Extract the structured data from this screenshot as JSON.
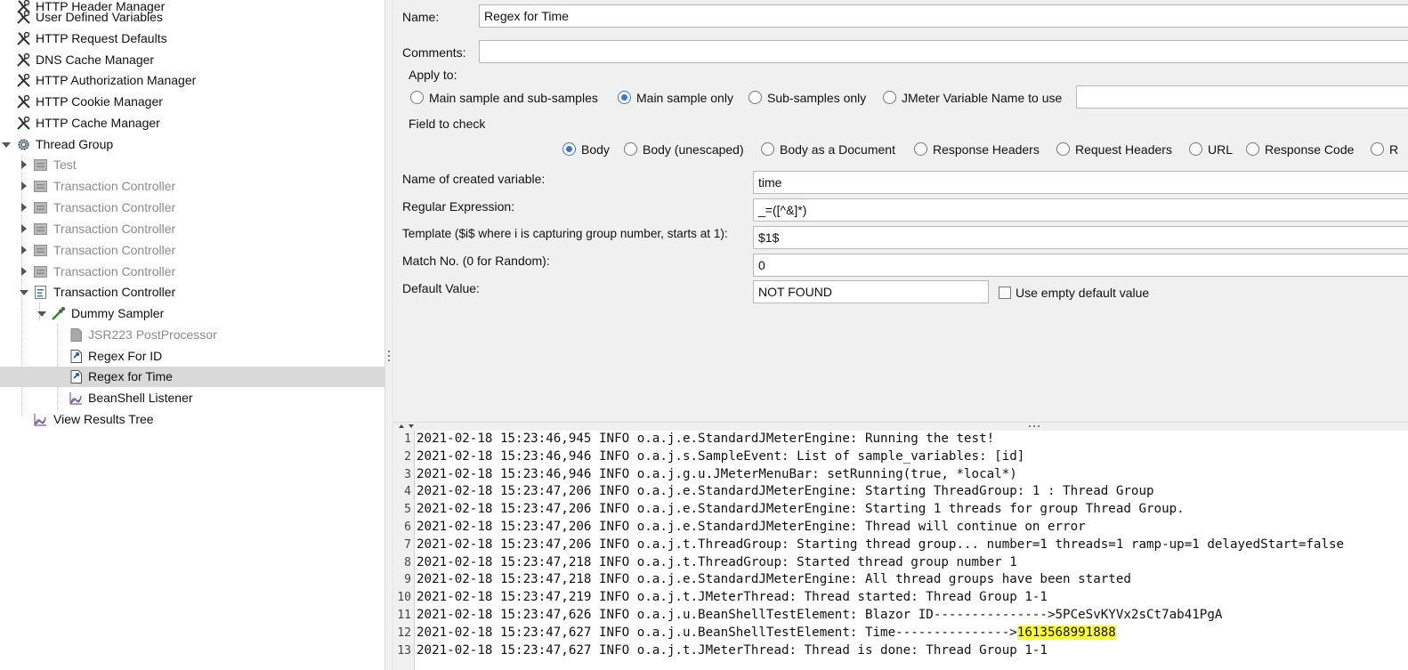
{
  "tree": {
    "items": [
      {
        "label": "HTTP Header Manager",
        "icon": "wrench-icon",
        "disabled": false
      },
      {
        "label": "User Defined Variables",
        "icon": "wrench-icon",
        "disabled": false
      },
      {
        "label": "HTTP Request Defaults",
        "icon": "wrench-icon",
        "disabled": false
      },
      {
        "label": "DNS Cache Manager",
        "icon": "wrench-icon",
        "disabled": false
      },
      {
        "label": "HTTP Authorization Manager",
        "icon": "wrench-icon",
        "disabled": false
      },
      {
        "label": "HTTP Cookie Manager",
        "icon": "wrench-icon",
        "disabled": false
      },
      {
        "label": "HTTP Cache Manager",
        "icon": "wrench-icon",
        "disabled": false
      },
      {
        "label": "Thread Group",
        "icon": "gear-icon",
        "disabled": false
      },
      {
        "label": "Test",
        "icon": "controller-icon",
        "disabled": true
      },
      {
        "label": "Transaction Controller",
        "icon": "controller-icon",
        "disabled": true
      },
      {
        "label": "Transaction Controller",
        "icon": "controller-icon",
        "disabled": true
      },
      {
        "label": "Transaction Controller",
        "icon": "controller-icon",
        "disabled": true
      },
      {
        "label": "Transaction Controller",
        "icon": "controller-icon",
        "disabled": true
      },
      {
        "label": "Transaction Controller",
        "icon": "controller-icon",
        "disabled": true
      },
      {
        "label": "Transaction Controller",
        "icon": "controller-icon",
        "disabled": false
      },
      {
        "label": "Dummy Sampler",
        "icon": "pipette-icon",
        "disabled": false
      },
      {
        "label": "JSR223 PostProcessor",
        "icon": "postprocessor-icon",
        "disabled": true
      },
      {
        "label": "Regex For ID",
        "icon": "postprocessor-icon",
        "disabled": false
      },
      {
        "label": "Regex for Time",
        "icon": "postprocessor-icon",
        "disabled": false
      },
      {
        "label": "BeanShell Listener",
        "icon": "chart-icon",
        "disabled": false
      },
      {
        "label": "View Results Tree",
        "icon": "chart-icon",
        "disabled": false
      }
    ]
  },
  "form": {
    "name_label": "Name:",
    "name_value": "Regex for Time",
    "comments_label": "Comments:",
    "comments_value": "",
    "apply_to_label": "Apply to:",
    "apply_to_options": [
      "Main sample and sub-samples",
      "Main sample only",
      "Sub-samples only",
      "JMeter Variable Name to use"
    ],
    "apply_to_selected": "Main sample only",
    "jmeter_var_value": "",
    "field_to_check_label": "Field to check",
    "field_options": [
      "Body",
      "Body (unescaped)",
      "Body as a Document",
      "Response Headers",
      "Request Headers",
      "URL",
      "Response Code",
      "R"
    ],
    "field_selected": "Body",
    "created_var_label": "Name of created variable:",
    "created_var_value": "time",
    "regex_label": "Regular Expression:",
    "regex_value": "_=([^&]*)",
    "template_label": "Template ($i$ where i is capturing group number, starts at 1):",
    "template_value": "$1$",
    "match_no_label": "Match No. (0 for Random):",
    "match_no_value": "0",
    "default_label": "Default Value:",
    "default_value": "NOT FOUND",
    "use_empty_label": "Use empty default value",
    "use_empty_checked": false
  },
  "console": {
    "lines": [
      {
        "n": "1",
        "text": "2021-02-18 15:23:46,945 INFO o.a.j.e.StandardJMeterEngine: Running the test!",
        "hl": ""
      },
      {
        "n": "2",
        "text": "2021-02-18 15:23:46,946 INFO o.a.j.s.SampleEvent: List of sample_variables: [id]",
        "hl": ""
      },
      {
        "n": "3",
        "text": "2021-02-18 15:23:46,946 INFO o.a.j.g.u.JMeterMenuBar: setRunning(true, *local*)",
        "hl": ""
      },
      {
        "n": "4",
        "text": "2021-02-18 15:23:47,206 INFO o.a.j.e.StandardJMeterEngine: Starting ThreadGroup: 1 : Thread Group",
        "hl": ""
      },
      {
        "n": "5",
        "text": "2021-02-18 15:23:47,206 INFO o.a.j.e.StandardJMeterEngine: Starting 1 threads for group Thread Group.",
        "hl": ""
      },
      {
        "n": "6",
        "text": "2021-02-18 15:23:47,206 INFO o.a.j.e.StandardJMeterEngine: Thread will continue on error",
        "hl": ""
      },
      {
        "n": "7",
        "text": "2021-02-18 15:23:47,206 INFO o.a.j.t.ThreadGroup: Starting thread group... number=1 threads=1 ramp-up=1 delayedStart=false",
        "hl": ""
      },
      {
        "n": "8",
        "text": "2021-02-18 15:23:47,218 INFO o.a.j.t.ThreadGroup: Started thread group number 1",
        "hl": ""
      },
      {
        "n": "9",
        "text": "2021-02-18 15:23:47,218 INFO o.a.j.e.StandardJMeterEngine: All thread groups have been started",
        "hl": ""
      },
      {
        "n": "10",
        "text": "2021-02-18 15:23:47,219 INFO o.a.j.t.JMeterThread: Thread started: Thread Group 1-1",
        "hl": ""
      },
      {
        "n": "11",
        "text": "2021-02-18 15:23:47,626 INFO o.a.j.u.BeanShellTestElement: Blazor ID--------------->5PCeSvKYVx2sCt7ab41PgA",
        "hl": ""
      },
      {
        "n": "12",
        "text": "2021-02-18 15:23:47,627 INFO o.a.j.u.BeanShellTestElement: Time--------------->",
        "hl": "1613568991888"
      },
      {
        "n": "13",
        "text": "2021-02-18 15:23:47,627 INFO o.a.j.t.JMeterThread: Thread is done: Thread Group 1-1",
        "hl": ""
      }
    ]
  },
  "colors": {
    "selection": "#d9d9d9",
    "highlight": "#ffff30",
    "radio_accent": "#3c78c8",
    "panel_bg": "#f0f0f0"
  }
}
